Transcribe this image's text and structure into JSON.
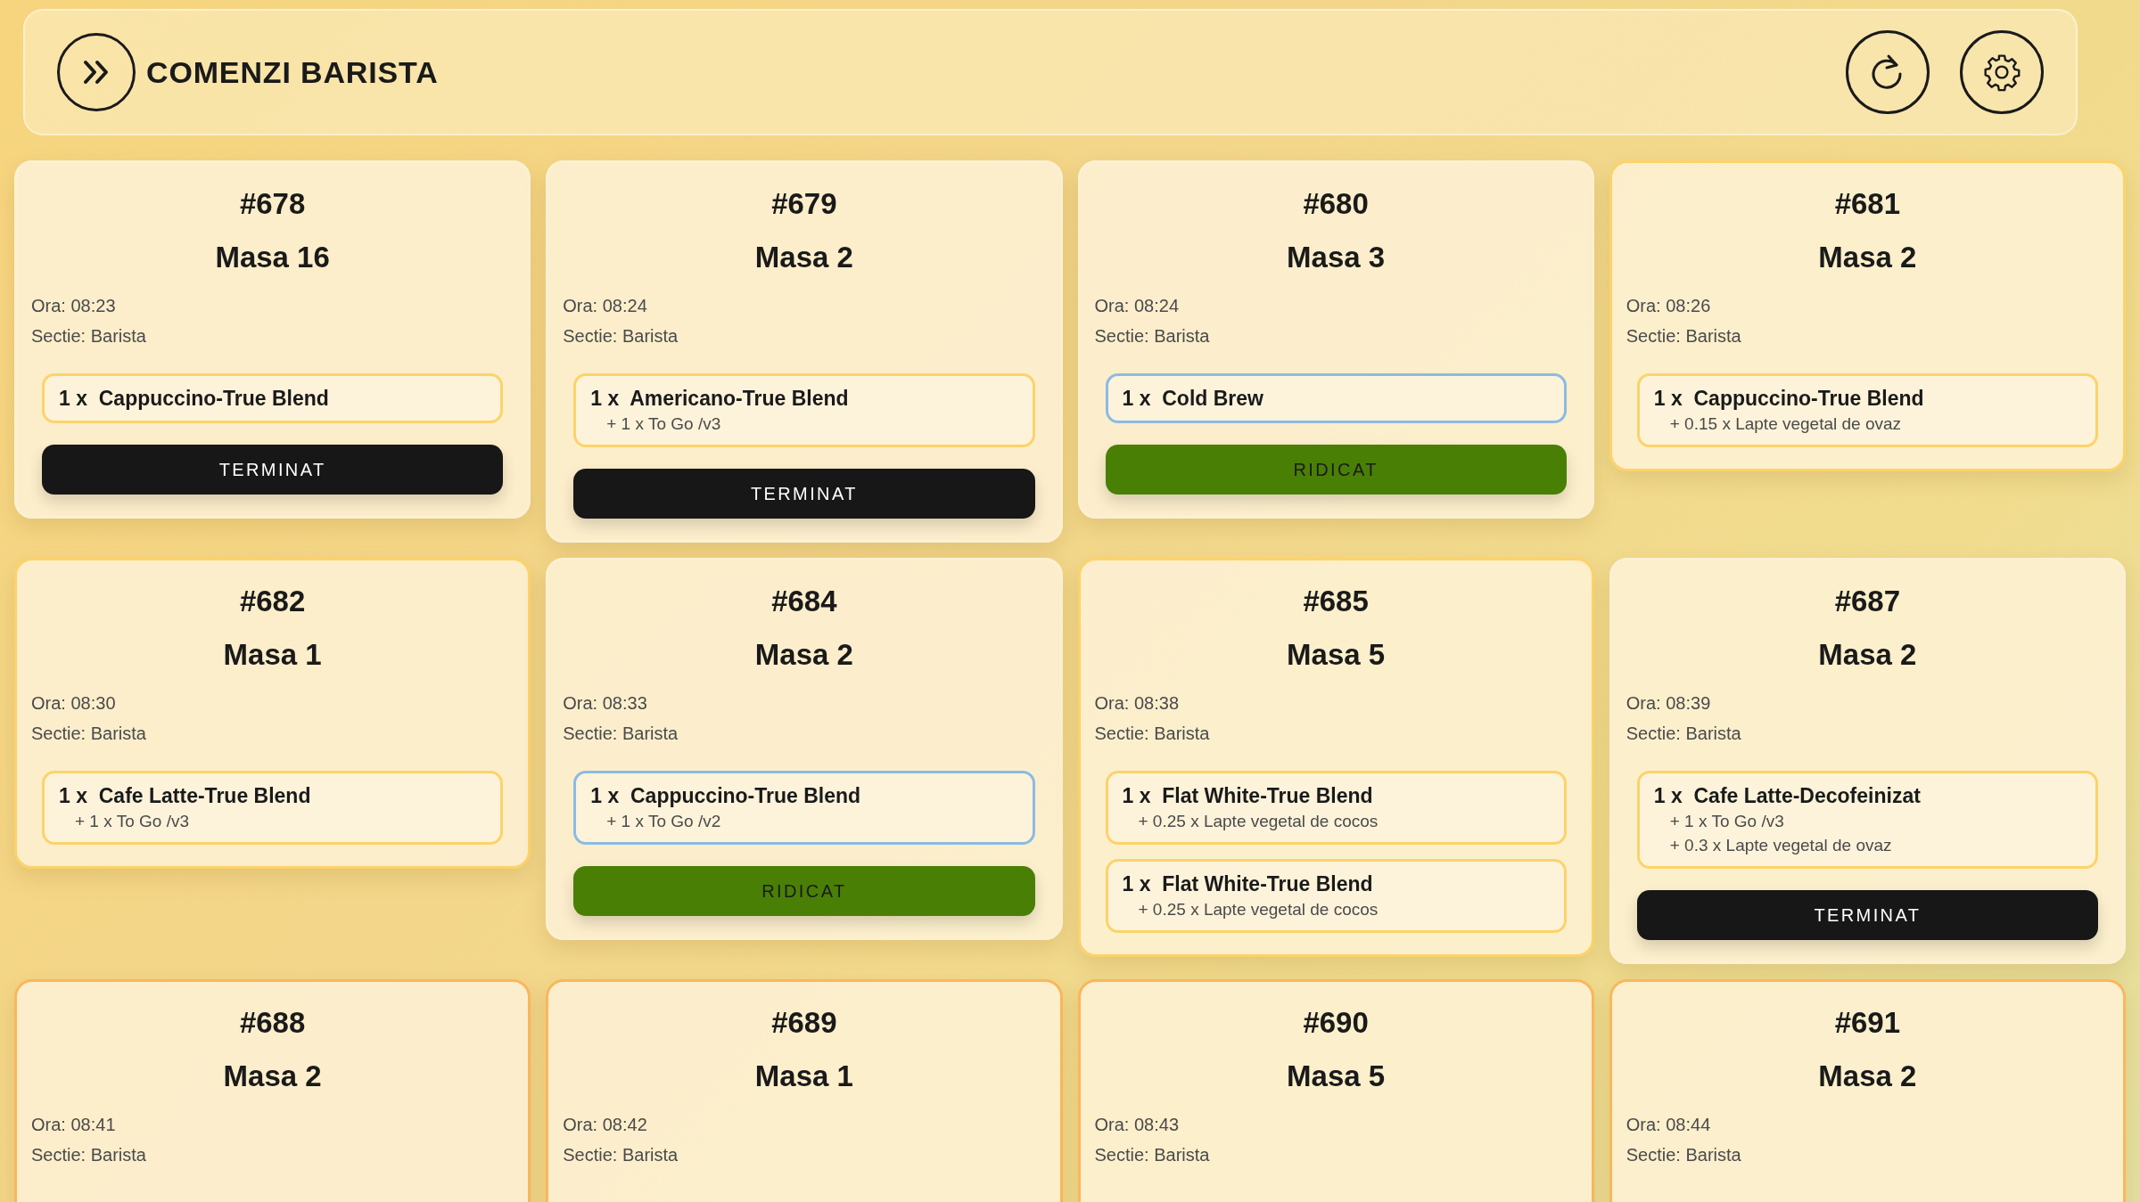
{
  "header": {
    "title": "COMENZI BARISTA"
  },
  "orders": [
    {
      "number": "#678",
      "table": "Masa 16",
      "time": "Ora: 08:23",
      "section": "Sectie: Barista",
      "color": "#fbf0d4",
      "items": [
        {
          "name": "1 x  Cappuccino-True Blend",
          "color": "#fcd36a"
        }
      ],
      "action": {
        "kind": "terminat",
        "label": "TERMINAT"
      }
    },
    {
      "number": "#679",
      "table": "Masa 2",
      "time": "Ora: 08:24",
      "section": "Sectie: Barista",
      "color": "#fbf0d4",
      "items": [
        {
          "name": "1 x  Americano-True Blend",
          "color": "#fcd36a",
          "extras": [
            "+ 1 x To Go /v3"
          ]
        }
      ],
      "action": {
        "kind": "terminat",
        "label": "TERMINAT"
      }
    },
    {
      "number": "#680",
      "table": "Masa 3",
      "time": "Ora: 08:24",
      "section": "Sectie: Barista",
      "color": "#fbf0d4",
      "items": [
        {
          "name": "1 x  Cold Brew",
          "color": "#8bbbe3"
        }
      ],
      "action": {
        "kind": "ridicat",
        "label": "RIDICAT"
      }
    },
    {
      "number": "#681",
      "table": "Masa 2",
      "time": "Ora: 08:26",
      "section": "Sectie: Barista",
      "color": "#fcd36a",
      "items": [
        {
          "name": "1 x  Cappuccino-True Blend",
          "color": "#fcd36a",
          "extras": [
            "+ 0.15 x Lapte vegetal de ovaz"
          ]
        }
      ]
    },
    {
      "number": "#682",
      "table": "Masa 1",
      "time": "Ora: 08:30",
      "section": "Sectie: Barista",
      "color": "#fcd36a",
      "items": [
        {
          "name": "1 x  Cafe Latte-True Blend",
          "color": "#fcd36a",
          "extras": [
            "+ 1 x To Go /v3"
          ]
        }
      ]
    },
    {
      "number": "#684",
      "table": "Masa 2",
      "time": "Ora: 08:33",
      "section": "Sectie: Barista",
      "color": "#fbf0d4",
      "items": [
        {
          "name": "1 x  Cappuccino-True Blend",
          "color": "#8bbbe3",
          "extras": [
            "+ 1 x To Go /v2"
          ]
        }
      ],
      "action": {
        "kind": "ridicat",
        "label": "RIDICAT"
      }
    },
    {
      "number": "#685",
      "table": "Masa 5",
      "time": "Ora: 08:38",
      "section": "Sectie: Barista",
      "color": "#fcd36a",
      "items": [
        {
          "name": "1 x  Flat White-True Blend",
          "color": "#fcd36a",
          "extras": [
            "+ 0.25 x Lapte vegetal de cocos"
          ]
        },
        {
          "name": "1 x  Flat White-True Blend",
          "color": "#fcd36a",
          "extras": [
            "+ 0.25 x Lapte vegetal de cocos"
          ]
        }
      ]
    },
    {
      "number": "#687",
      "table": "Masa 2",
      "time": "Ora: 08:39",
      "section": "Sectie: Barista",
      "color": "#fbf0d4",
      "items": [
        {
          "name": "1 x  Cafe Latte-Decofeinizat",
          "color": "#fcd36a",
          "extras": [
            "+ 1 x To Go /v3",
            "+ 0.3 x Lapte vegetal de ovaz"
          ]
        }
      ],
      "action": {
        "kind": "terminat",
        "label": "TERMINAT"
      }
    },
    {
      "number": "#688",
      "table": "Masa 2",
      "time": "Ora: 08:41",
      "section": "Sectie: Barista",
      "color": "#f9b75c"
    },
    {
      "number": "#689",
      "table": "Masa 1",
      "time": "Ora: 08:42",
      "section": "Sectie: Barista",
      "color": "#f9b75c"
    },
    {
      "number": "#690",
      "table": "Masa 5",
      "time": "Ora: 08:43",
      "section": "Sectie: Barista",
      "color": "#f9b75c"
    },
    {
      "number": "#691",
      "table": "Masa 2",
      "time": "Ora: 08:44",
      "section": "Sectie: Barista",
      "color": "#f9b75c"
    }
  ]
}
